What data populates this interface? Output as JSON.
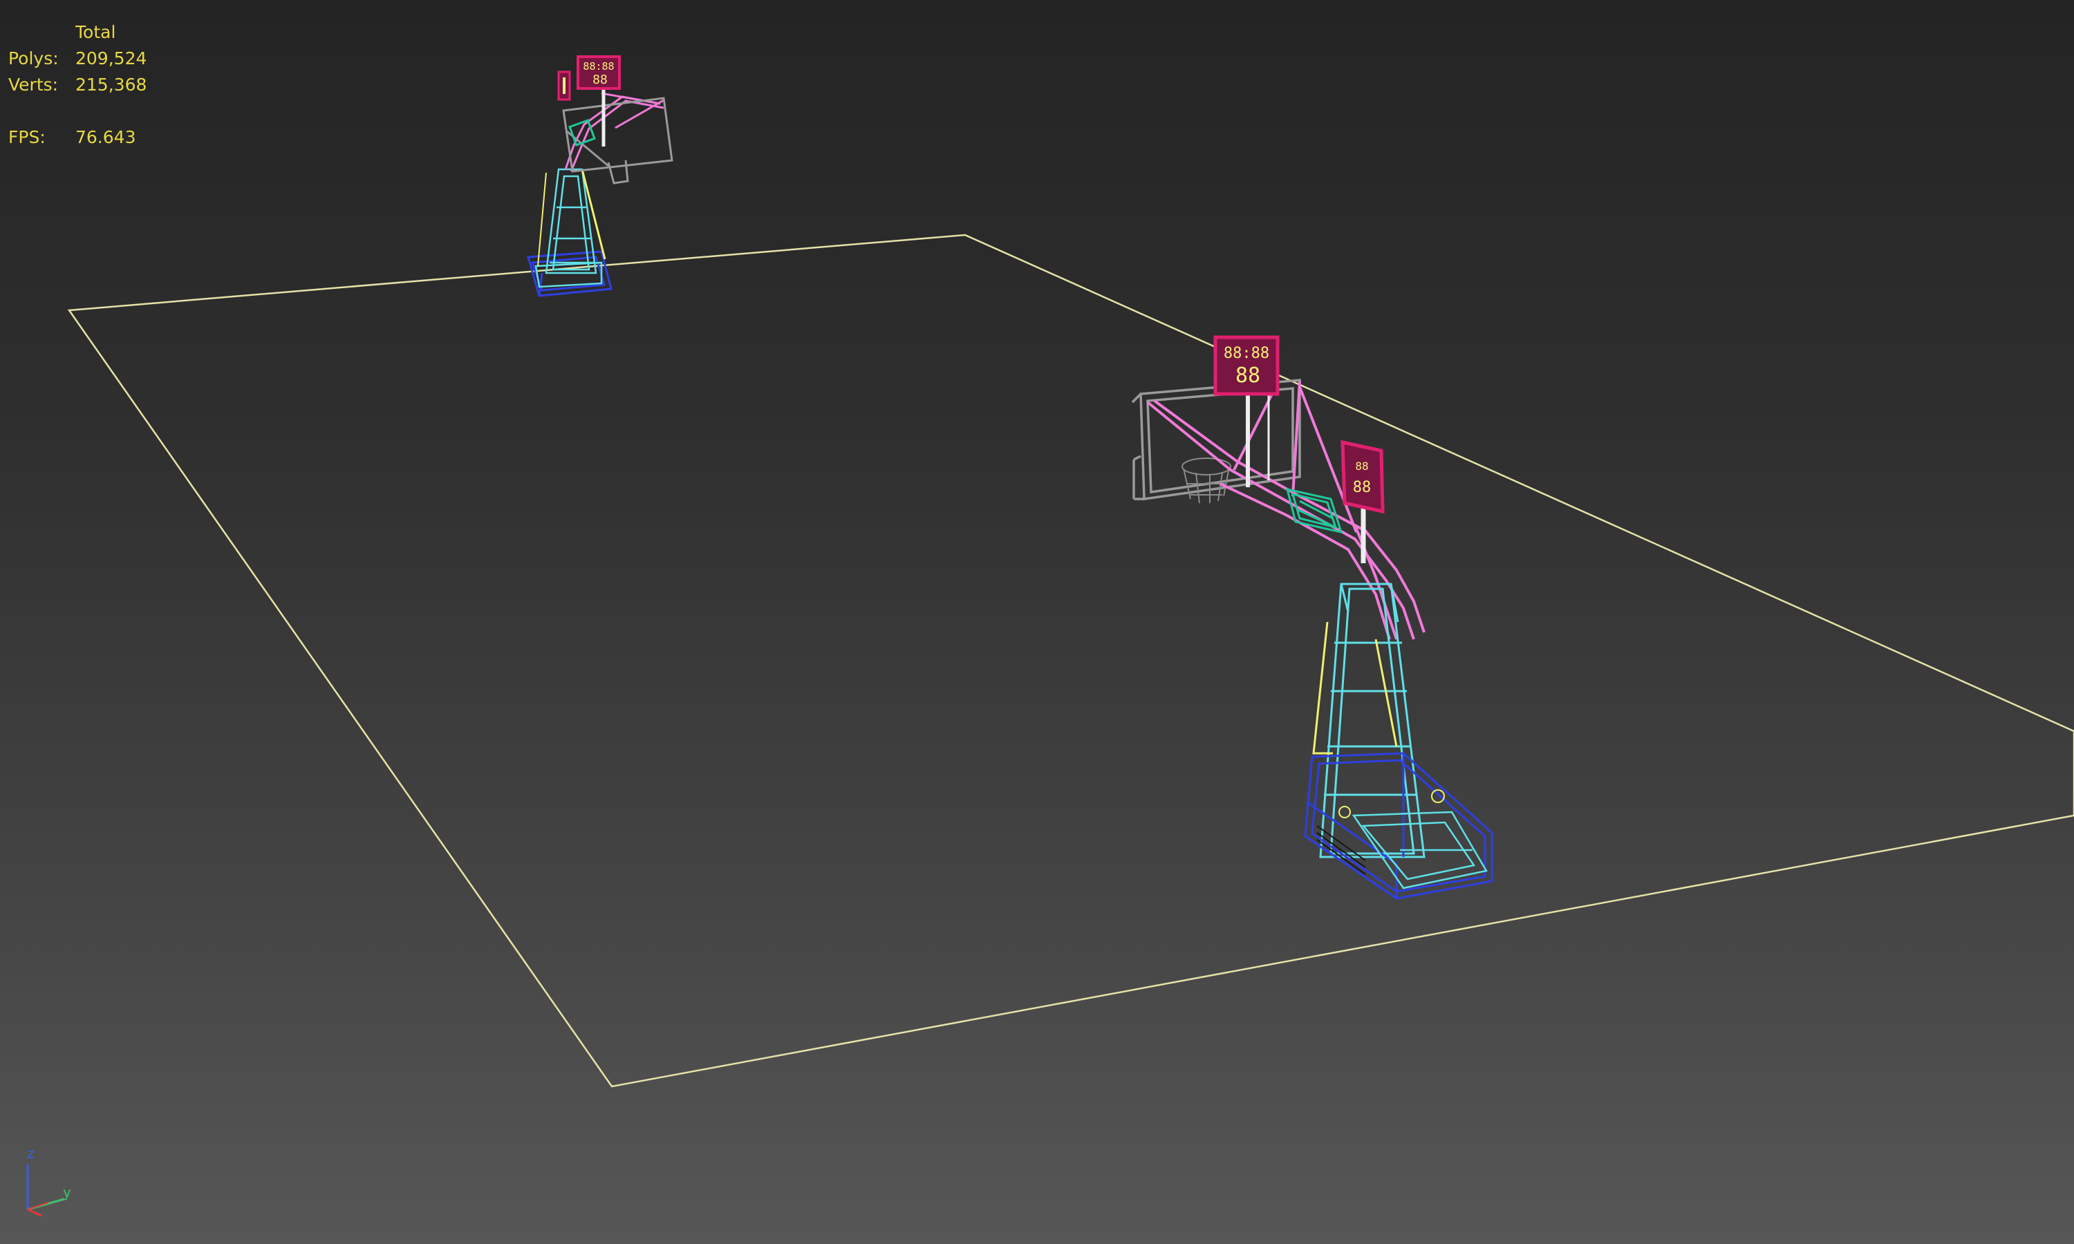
{
  "viewport": {
    "stats": {
      "header": "Total",
      "polys_label": "Polys:",
      "polys_value": "209,524",
      "verts_label": "Verts:",
      "verts_value": "215,368",
      "fps_label": "FPS:",
      "fps_value": "76.643"
    },
    "axis_gizmo": {
      "z_label": "z",
      "y_label": "y"
    },
    "scoreboard_digits": "88:88",
    "scoreboard_digits_small": "88"
  },
  "colors": {
    "stats_text": "#e8d845",
    "court_outline": "#e6e2a8",
    "scoreboard_frame": "#e0206f",
    "scoreboard_digits": "#f2f27a",
    "hoop_frame": "#9a9a9a",
    "boom_arm": "#f07ad8",
    "column": "#5fe0e8",
    "base": "#2f3fe0",
    "support": "#f0f070",
    "pad": "#1fc89a",
    "axis_z": "#3a5fe0",
    "axis_y": "#3fc070",
    "axis_x": "#e03a3a"
  }
}
